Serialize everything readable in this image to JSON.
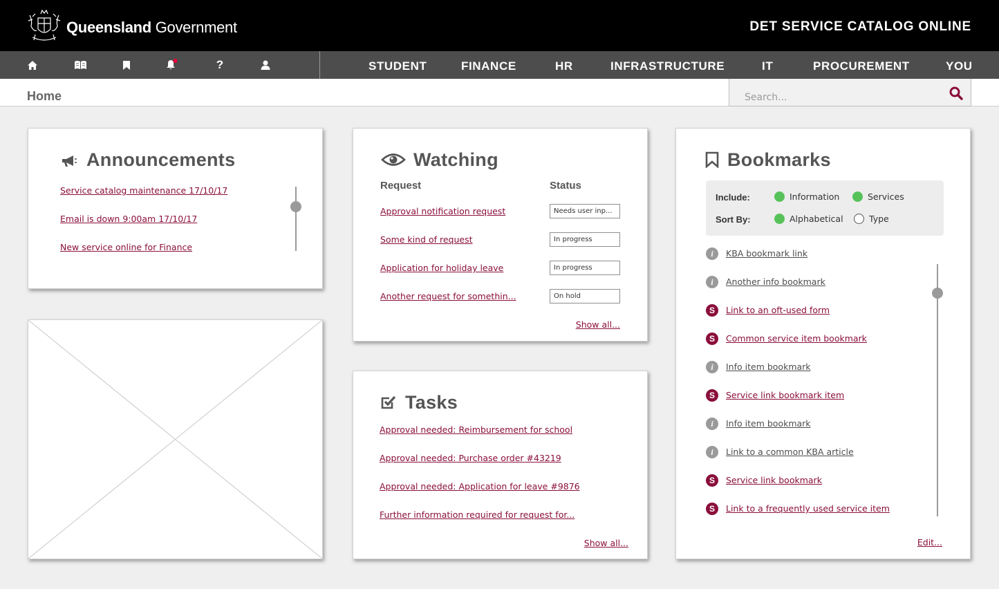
{
  "header": {
    "brand_bold": "Queensland",
    "brand_rest": " Government",
    "app_title": "DET SERVICE CATALOG ONLINE"
  },
  "nav": {
    "icons": [
      "home-icon",
      "book-icon",
      "bookmark-icon",
      "bell-icon",
      "help-icon",
      "user-icon"
    ],
    "help_glyph": "?",
    "notification_dot_color": "#e8003d",
    "links": [
      "STUDENT",
      "FINANCE",
      "HR",
      "INFRASTRUCTURE",
      "IT",
      "PROCUREMENT",
      "YOU"
    ]
  },
  "breadcrumb": {
    "current": "Home"
  },
  "search": {
    "placeholder": "Search..."
  },
  "announcements": {
    "title": "Announcements",
    "items": [
      "Service catalog maintenance 17/10/17",
      "Email is down 9:00am 17/10/17",
      "New service online for Finance"
    ]
  },
  "watching": {
    "title": "Watching",
    "col_request": "Request",
    "col_status": "Status",
    "rows": [
      {
        "request": "Approval notification request",
        "status": "Needs user inp..."
      },
      {
        "request": "Some kind of request",
        "status": "In progress"
      },
      {
        "request": "Application for holiday leave",
        "status": "In progress"
      },
      {
        "request": "Another request for somethin...",
        "status": "On hold"
      }
    ],
    "show_all": "Show all..."
  },
  "tasks": {
    "title": "Tasks",
    "items": [
      "Approval needed: Reimbursement for school ",
      "Approval needed: Purchase order #43219",
      "Approval needed: Application for leave #9876",
      "Further information required for request for..."
    ],
    "show_all": "Show all..."
  },
  "bookmarks": {
    "title": "Bookmarks",
    "include_label": "Include:",
    "sort_label": "Sort By:",
    "include_options": [
      {
        "label": "Information",
        "selected": true
      },
      {
        "label": "Services",
        "selected": true
      }
    ],
    "sort_options": [
      {
        "label": "Alphabetical",
        "selected": true
      },
      {
        "label": "Type",
        "selected": false
      }
    ],
    "info_glyph": "i",
    "service_glyph": "S",
    "items": [
      {
        "type": "info",
        "label": "KBA bookmark link"
      },
      {
        "type": "info",
        "label": "Another info bookmark"
      },
      {
        "type": "service",
        "label": "Link to an oft-used form"
      },
      {
        "type": "service",
        "label": "Common service item bookmark"
      },
      {
        "type": "info",
        "label": "Info item bookmark"
      },
      {
        "type": "service",
        "label": "Service link bookmark item"
      },
      {
        "type": "info",
        "label": "Info item bookmark"
      },
      {
        "type": "info",
        "label": "Link to a common KBA article"
      },
      {
        "type": "service",
        "label": "Service link bookmark"
      },
      {
        "type": "service",
        "label": "Link to a frequently used service item"
      }
    ],
    "edit": "Edit..."
  },
  "colors": {
    "link": "#8a0f3b",
    "topbar": "#000000",
    "navbar": "#4d4d4d",
    "selected_dot": "#57c25a"
  }
}
